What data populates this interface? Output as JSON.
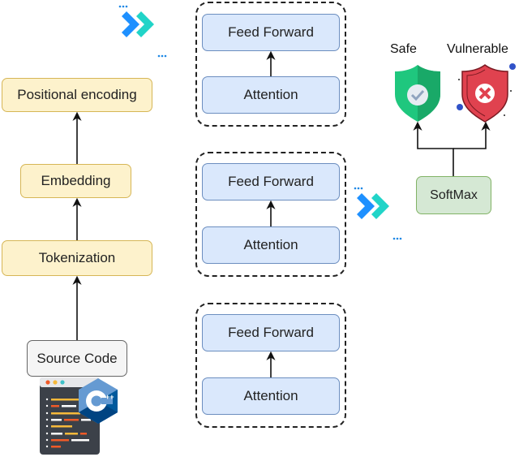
{
  "pipeline": {
    "positional_encoding": "Positional encoding",
    "embedding": "Embedding",
    "tokenization": "Tokenization",
    "source_code": "Source Code"
  },
  "encoder_blocks": [
    {
      "top": "Feed Forward",
      "bottom": "Attention"
    },
    {
      "top": "Feed Forward",
      "bottom": "Attention"
    },
    {
      "top": "Feed Forward",
      "bottom": "Attention"
    }
  ],
  "classifier": {
    "softmax": "SoftMax",
    "safe": "Safe",
    "vulnerable": "Vulnerable"
  },
  "icons": {
    "code_editor": "code-editor-icon",
    "cpp_logo": "cpp-logo-icon",
    "arrows": "double-chevron-icon",
    "safe": "shield-check-icon",
    "vulnerable": "shield-x-icon"
  },
  "colors": {
    "yellow_fill": "#fdf2cc",
    "yellow_border": "#d6b656",
    "blue_fill": "#dae8fc",
    "blue_border": "#6c8ebf",
    "green_fill": "#d5e8d4",
    "green_border": "#82b366",
    "safe_green": "#1fc77e",
    "vuln_red": "#e0424f"
  }
}
